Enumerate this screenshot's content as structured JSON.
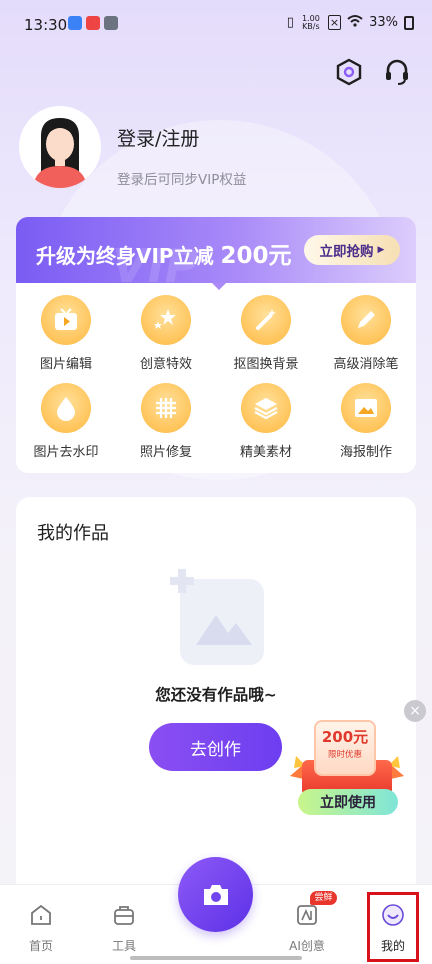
{
  "status_bar": {
    "time": "13:30",
    "net_speed_value": "1.00",
    "net_speed_unit": "KB/s",
    "battery": "33%"
  },
  "profile": {
    "login_title": "登录/注册",
    "login_subtitle": "登录后可同步VIP权益"
  },
  "vip_banner": {
    "text": "升级为终身VIP立减 ",
    "amount": "200元",
    "watermark": "VIP",
    "button_label": "立即抢购"
  },
  "tools": [
    {
      "label": "图片编辑",
      "icon": "tv-play-icon"
    },
    {
      "label": "创意特效",
      "icon": "stars-icon"
    },
    {
      "label": "抠图换背景",
      "icon": "magic-wand-icon"
    },
    {
      "label": "高级消除笔",
      "icon": "pencil-icon"
    },
    {
      "label": "图片去水印",
      "icon": "water-drop-icon"
    },
    {
      "label": "照片修复",
      "icon": "grid-icon"
    },
    {
      "label": "精美素材",
      "icon": "layers-icon"
    },
    {
      "label": "海报制作",
      "icon": "image-frame-icon"
    }
  ],
  "works": {
    "title": "我的作品",
    "empty_text": "您还没有作品哦~",
    "create_button": "去创作"
  },
  "promo": {
    "amount": "200元",
    "subtitle": "限时优惠",
    "button_label": "立即使用",
    "close": "×"
  },
  "bottom_nav": {
    "home": "首页",
    "tools": "工具",
    "ai": "AI创意",
    "ai_badge": "尝鲜",
    "mine": "我的"
  },
  "colors": {
    "accent": "#7a4ff2",
    "tool_icon": "#ffc45a",
    "badge_red": "#e8362c"
  }
}
